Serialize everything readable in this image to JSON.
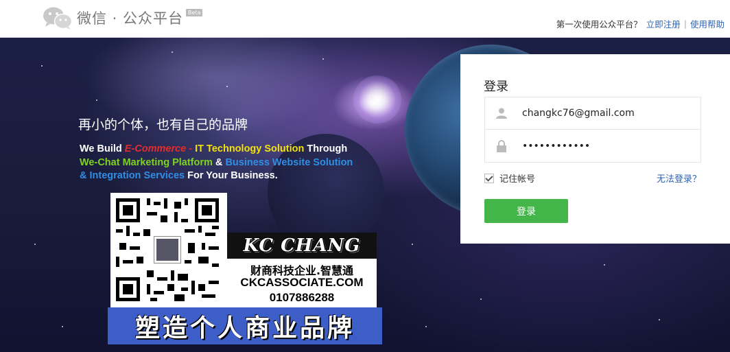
{
  "header": {
    "logo_title": "微信 · 公众平台",
    "logo_badge": "Beta",
    "first_time_text": "第一次使用公众平台？",
    "register_link": "立即注册",
    "separator": "|",
    "help_link": "使用帮助"
  },
  "banner": {
    "tagline": "再小的个体，也有自己的品牌",
    "promo": {
      "p1": "We Build ",
      "p2": "E-Commerce",
      "p3": " - ",
      "p4": "IT Technology Solution",
      "p5": " Through",
      "p6": "We-Chat Marketing Platform",
      "p7": " & ",
      "p8": "Business Website Solution",
      "p9": "& Integration Services",
      "p10": " For Your Business."
    },
    "ad": {
      "name": "KC CHANG",
      "subtitle": "财商科技企业.智慧通",
      "website": "CKCASSOCIATE.COM",
      "phone": "0107886288",
      "brand_slogan": "塑造个人商业品牌"
    }
  },
  "login": {
    "title": "登录",
    "username_value": "changkc76@gmail.com",
    "password_value": "••••••••••••",
    "remember_label": "记住帐号",
    "remember_checked": true,
    "forgot_link": "无法登录？",
    "submit_label": "登录"
  },
  "colors": {
    "primary_button": "#44b549",
    "link": "#2d64b3",
    "banner_bg": "#1a1c3c",
    "brand_banner": "#3d5ec7"
  }
}
